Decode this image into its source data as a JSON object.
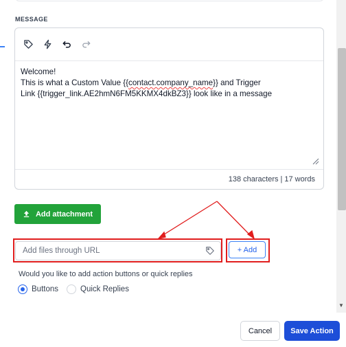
{
  "message_section": {
    "label": "MESSAGE",
    "toolbar": {
      "icons": [
        "tag-icon",
        "lightning-icon",
        "undo-icon",
        "redo-icon"
      ]
    },
    "body": {
      "line1": "Welcome!",
      "line2_prefix": "This is what a Custom Value {{",
      "line2_token": "contact.company_name",
      "line2_suffix": "}} and Trigger",
      "line3": "Link {{trigger_link.AE2hmN6FM5KKMX4dkBZ3}} look like in a message"
    },
    "counter": {
      "characters": "138 characters",
      "separator": "|",
      "words": "17 words"
    }
  },
  "attachment": {
    "button_label": "Add attachment",
    "url_placeholder": "Add files through URL",
    "add_button_label": "+ Add"
  },
  "action_buttons": {
    "question": "Would you like to add action buttons or quick replies",
    "options": [
      {
        "label": "Buttons",
        "selected": true
      },
      {
        "label": "Quick Replies",
        "selected": false
      }
    ]
  },
  "footer": {
    "cancel_label": "Cancel",
    "save_label": "Save Action"
  },
  "colors": {
    "primary": "#1d4ed8",
    "success": "#22a33a",
    "annotation": "#e11d1d"
  }
}
